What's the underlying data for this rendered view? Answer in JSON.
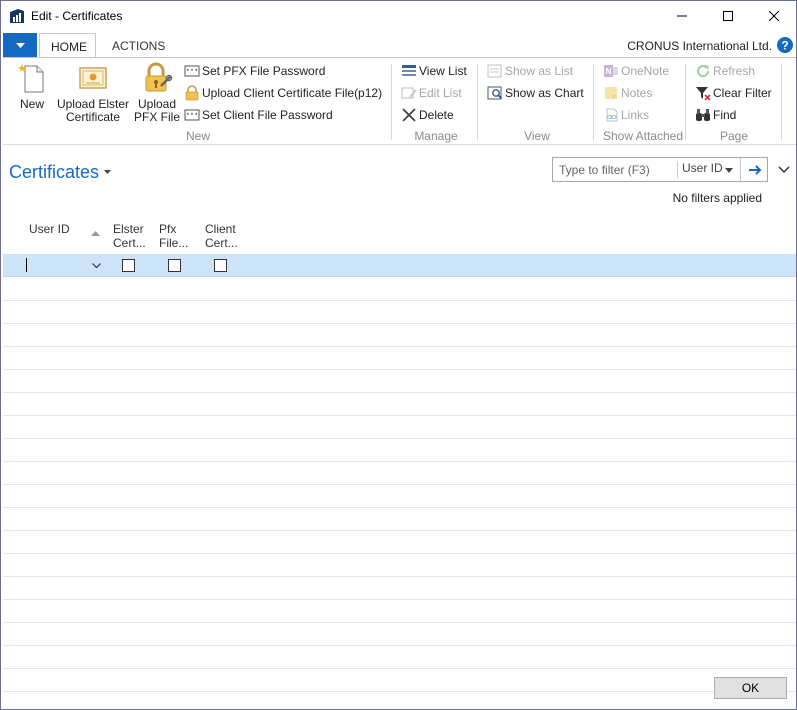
{
  "window": {
    "title": "Edit - Certificates",
    "controls": [
      "minimize-icon",
      "maximize-icon",
      "close-icon"
    ]
  },
  "ribbon_tabs": {
    "items": [
      {
        "label": "HOME",
        "active": true
      },
      {
        "label": "ACTIONS",
        "active": false
      }
    ],
    "company": "CRONUS International Ltd."
  },
  "ribbon": {
    "groups": {
      "new": "New",
      "manage": "Manage",
      "view": "View",
      "show_attached": "Show Attached",
      "page": "Page"
    },
    "new_button": "New",
    "upload_elster_line1": "Upload Elster",
    "upload_elster_line2": "Certificate",
    "upload_pfx_line1": "Upload",
    "upload_pfx_line2": "PFX File",
    "set_pfx_password": "Set PFX File Password",
    "upload_client_cert": "Upload Client Certificate File(p12)",
    "set_client_password": "Set Client File Password",
    "view_list": "View List",
    "edit_list": "Edit List",
    "delete": "Delete",
    "show_as_list": "Show as List",
    "show_as_chart": "Show as Chart",
    "onenote": "OneNote",
    "notes": "Notes",
    "links": "Links",
    "refresh": "Refresh",
    "clear_filter": "Clear Filter",
    "find": "Find"
  },
  "page": {
    "title": "Certificates",
    "filter_placeholder": "Type to filter (F3)",
    "filter_field": "User ID",
    "filter_status": "No filters applied"
  },
  "grid": {
    "columns": [
      {
        "line1": "User ID",
        "line2": ""
      },
      {
        "line1": "Elster",
        "line2": "Cert..."
      },
      {
        "line1": "Pfx",
        "line2": "File..."
      },
      {
        "line1": "Client",
        "line2": "Cert..."
      }
    ],
    "rows": [
      {
        "user_id": "",
        "elster": false,
        "pfx": false,
        "client": false
      }
    ],
    "empty_row_count": 18
  },
  "footer": {
    "ok_label": "OK"
  },
  "colors": {
    "accent": "#1669c1",
    "selected_row": "#cde3f7",
    "disabled_text": "#a6a6a6"
  }
}
